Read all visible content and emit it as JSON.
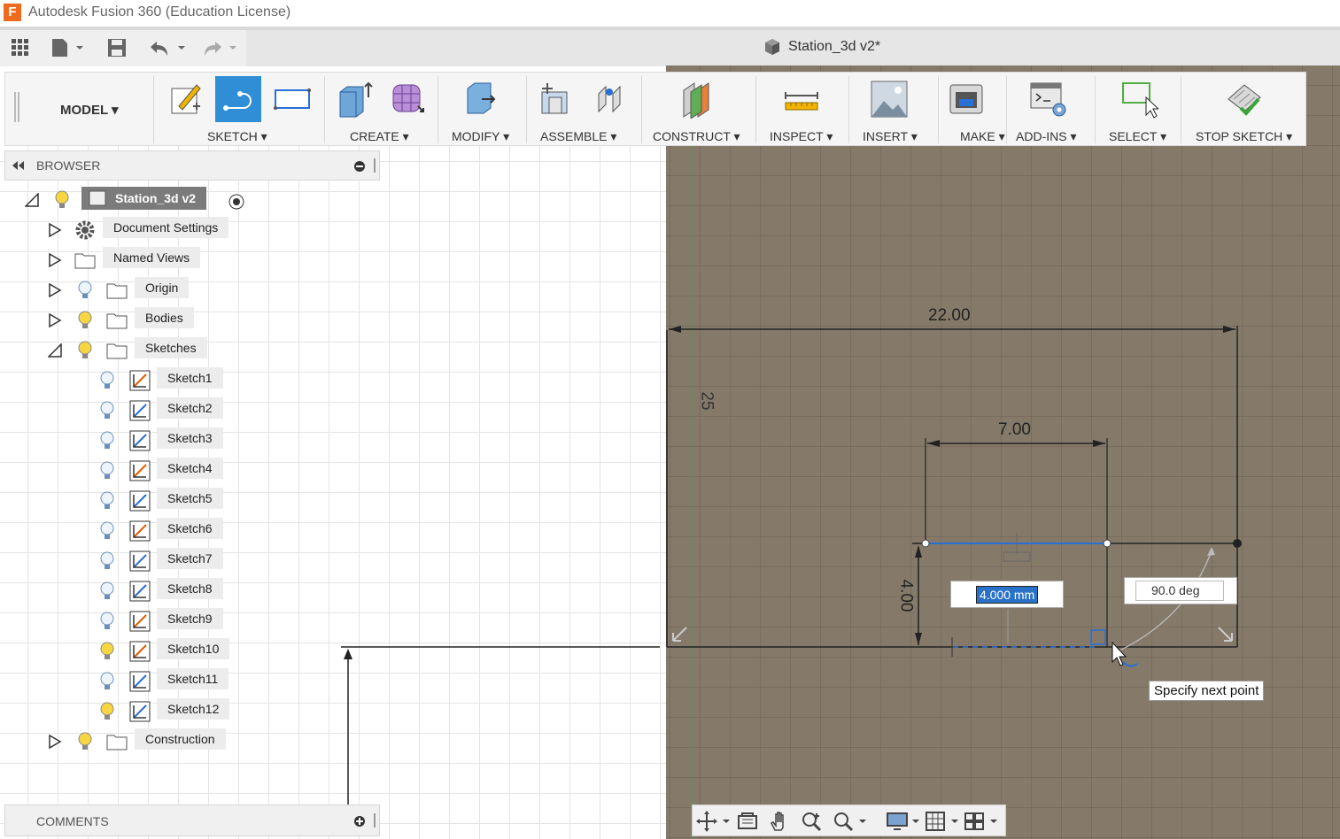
{
  "window": {
    "title": "Autodesk Fusion 360 (Education License)",
    "logo_letter": "F"
  },
  "document": {
    "tab_title": "Station_3d v2*"
  },
  "ribbon": {
    "workspace": "MODEL ▾",
    "groups": [
      "SKETCH ▾",
      "CREATE ▾",
      "MODIFY ▾",
      "ASSEMBLE ▾",
      "CONSTRUCT ▾",
      "INSPECT ▾",
      "INSERT ▾",
      "MAKE ▾",
      "ADD-INS ▾",
      "SELECT ▾",
      "STOP SKETCH ▾"
    ]
  },
  "browser": {
    "title": "BROWSER",
    "root": "Station_3d v2",
    "items": [
      "Document Settings",
      "Named Views",
      "Origin",
      "Bodies",
      "Sketches"
    ],
    "sketches": [
      "Sketch1",
      "Sketch2",
      "Sketch3",
      "Sketch4",
      "Sketch5",
      "Sketch6",
      "Sketch7",
      "Sketch8",
      "Sketch9",
      "Sketch10",
      "Sketch11",
      "Sketch12"
    ],
    "construction": "Construction"
  },
  "comments": {
    "title": "COMMENTS"
  },
  "sketch": {
    "dim_width_total": "22.00",
    "dim_width_inner": "7.00",
    "dim_height": "4.00",
    "dim_vertical": "25",
    "length_input": "4.000 mm",
    "angle_input": "90.0 deg",
    "tooltip": "Specify next point"
  },
  "colors": {
    "accent": "#2f8ed6",
    "canvas_dark": "#857a6a",
    "sketch_line": "#2a6fd6"
  }
}
